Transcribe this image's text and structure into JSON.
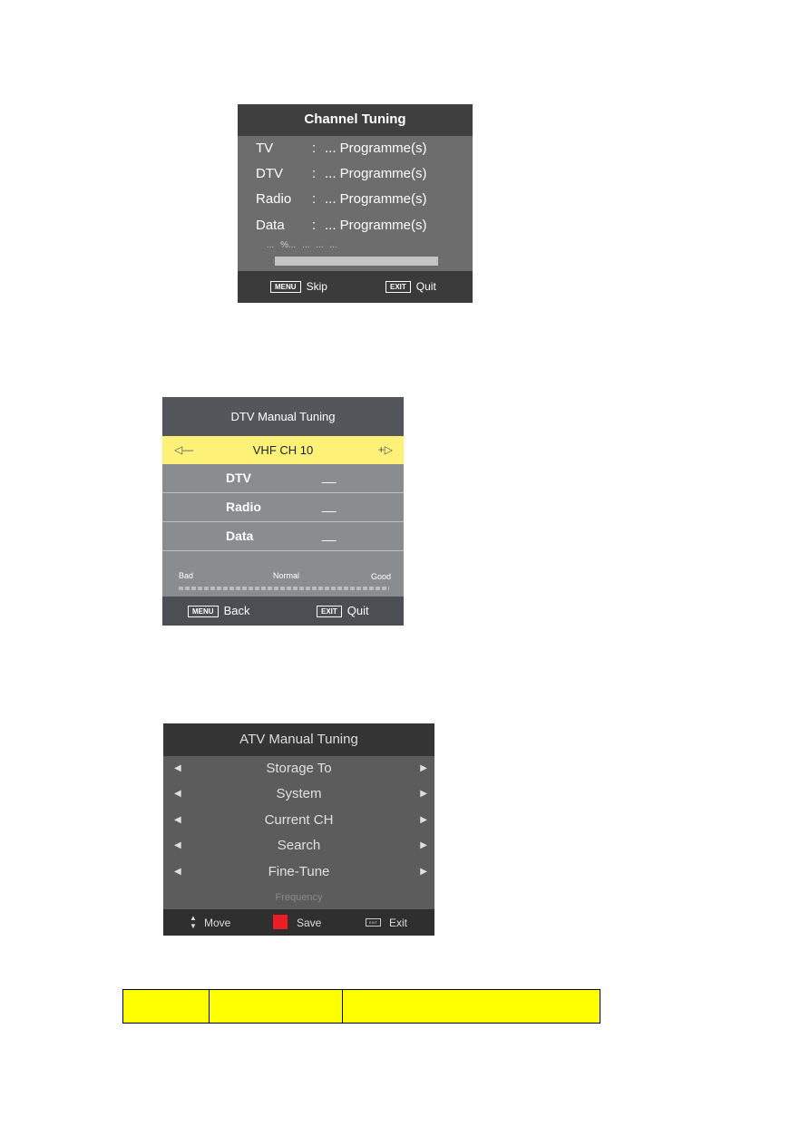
{
  "channel_tuning": {
    "title": "Channel Tuning",
    "rows": [
      {
        "label": "TV",
        "sep": ":",
        "value": "... Programme(s)"
      },
      {
        "label": "DTV",
        "sep": ":",
        "value": "... Programme(s)"
      },
      {
        "label": "Radio",
        "sep": ":",
        "value": "... Programme(s)"
      },
      {
        "label": "Data",
        "sep": ":",
        "value": "... Programme(s)"
      }
    ],
    "status": "... %... ...     ...   ...",
    "footer": {
      "menu_key": "MENU",
      "menu_label": "Skip",
      "exit_key": "EXIT",
      "exit_label": "Quit"
    }
  },
  "dtv_manual_tuning": {
    "title": "DTV Manual Tuning",
    "left_arrow": "◁—",
    "right_arrow": "+▷",
    "channel": "VHF CH 10",
    "rows": [
      {
        "label": "DTV",
        "value": "__"
      },
      {
        "label": "Radio",
        "value": "__"
      },
      {
        "label": "Data",
        "value": "__"
      }
    ],
    "signal": {
      "bad": "Bad",
      "normal": "Normal",
      "good": "Good"
    },
    "footer": {
      "menu_key": "MENU",
      "menu_label": "Back",
      "exit_key": "EXIT",
      "exit_label": "Quit"
    }
  },
  "atv_manual_tuning": {
    "title": "ATV Manual Tuning",
    "items": [
      "Storage To",
      "System",
      "Current CH",
      "Search",
      "Fine-Tune"
    ],
    "frequency": "Frequency",
    "footer": {
      "move": "Move",
      "save": "Save",
      "exit_key": "EXIT",
      "exit": "Exit"
    },
    "save_color": "#ee1c25"
  },
  "table": {
    "highlight": "#ffff00"
  }
}
